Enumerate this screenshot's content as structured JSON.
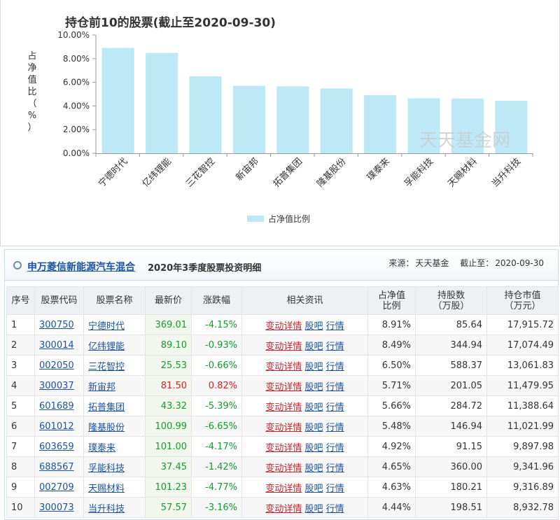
{
  "chart": {
    "title": "持仓前10的股票(截止至2020-09-30)",
    "y_axis_title": [
      "占",
      "净",
      "值",
      "比",
      "（",
      "%",
      "）"
    ],
    "watermark": "天天基金网",
    "legend_label": "占净值比例"
  },
  "chart_data": {
    "type": "bar",
    "title": "持仓前10的股票(截止至2020-09-30)",
    "ylabel": "占净值比（%）",
    "xlabel": "",
    "categories": [
      "宁德时代",
      "亿纬锂能",
      "三花智控",
      "新宙邦",
      "拓普集团",
      "隆基股份",
      "璞泰来",
      "孚能科技",
      "天赐材料",
      "当升科技"
    ],
    "series": [
      {
        "name": "占净值比例",
        "values": [
          8.91,
          8.49,
          6.5,
          5.71,
          5.66,
          5.48,
          4.92,
          4.65,
          4.63,
          4.44
        ]
      }
    ],
    "ylim": [
      0,
      10
    ],
    "yticks": [
      "0.00%",
      "2.00%",
      "4.00%",
      "6.00%",
      "8.00%",
      "10.00%"
    ],
    "grid": false,
    "legend": "bottom-center",
    "bar_color": "#bde9f7"
  },
  "detail": {
    "fund_name": "申万菱信新能源汽车混合",
    "report_title": "2020年3季度股票投资明细",
    "source_label": "来源：",
    "source_value": "天天基金",
    "date_label": "截止至：",
    "date_value": "2020-09-30"
  },
  "table": {
    "headers": {
      "no": "序号",
      "code": "股票代码",
      "name": "股票名称",
      "price": "最新价",
      "change": "涨跌幅",
      "info": "相关资讯",
      "ratio": "占净值比例",
      "ratio_line1": "占净值",
      "ratio_line2": "比例",
      "shares_line1": "持股数",
      "shares_line2": "（万股）",
      "value_line1": "持仓市值",
      "value_line2": "（万元）"
    },
    "link_labels": {
      "detail": "变动详情",
      "bar": "股吧",
      "quote": "行情"
    },
    "rows": [
      {
        "no": "1",
        "code": "300750",
        "name": "宁德时代",
        "price": "369.01",
        "change": "-4.15%",
        "ratio": "8.91%",
        "shares": "85.64",
        "value": "17,915.72"
      },
      {
        "no": "2",
        "code": "300014",
        "name": "亿纬锂能",
        "price": "89.10",
        "change": "-0.93%",
        "ratio": "8.49%",
        "shares": "344.94",
        "value": "17,074.49"
      },
      {
        "no": "3",
        "code": "002050",
        "name": "三花智控",
        "price": "25.53",
        "change": "-0.66%",
        "ratio": "6.50%",
        "shares": "588.37",
        "value": "13,061.83"
      },
      {
        "no": "4",
        "code": "300037",
        "name": "新宙邦",
        "price": "81.50",
        "change": "0.82%",
        "ratio": "5.71%",
        "shares": "201.05",
        "value": "11,479.95"
      },
      {
        "no": "5",
        "code": "601689",
        "name": "拓普集团",
        "price": "43.32",
        "change": "-5.39%",
        "ratio": "5.66%",
        "shares": "284.72",
        "value": "11,388.64"
      },
      {
        "no": "6",
        "code": "601012",
        "name": "隆基股份",
        "price": "100.99",
        "change": "-6.65%",
        "ratio": "5.48%",
        "shares": "146.94",
        "value": "11,021.99"
      },
      {
        "no": "7",
        "code": "603659",
        "name": "璞泰来",
        "price": "101.00",
        "change": "-4.17%",
        "ratio": "4.92%",
        "shares": "91.15",
        "value": "9,897.98"
      },
      {
        "no": "8",
        "code": "688567",
        "name": "孚能科技",
        "price": "37.45",
        "change": "-1.42%",
        "ratio": "4.65%",
        "shares": "360.00",
        "value": "9,341.96"
      },
      {
        "no": "9",
        "code": "002709",
        "name": "天赐材料",
        "price": "101.23",
        "change": "-4.77%",
        "ratio": "4.63%",
        "shares": "180.21",
        "value": "9,316.89"
      },
      {
        "no": "10",
        "code": "300073",
        "name": "当升科技",
        "price": "57.57",
        "change": "-3.16%",
        "ratio": "4.44%",
        "shares": "198.51",
        "value": "8,932.78"
      }
    ],
    "colors": {
      "up": "#e02222",
      "down": "#169b2d",
      "link": "#1d53a1",
      "link_red": "#c9242b"
    }
  }
}
